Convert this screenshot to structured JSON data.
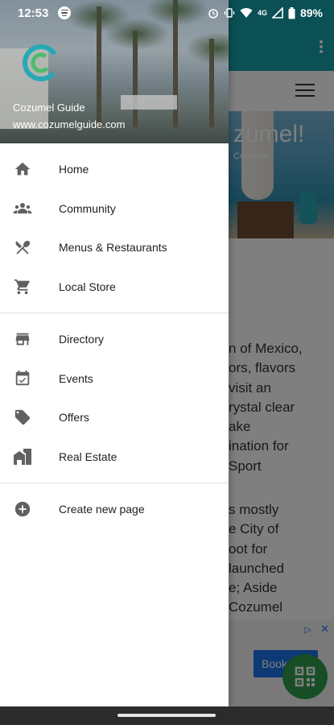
{
  "status_bar": {
    "time": "12:53",
    "network": "4G",
    "battery": "89%"
  },
  "background": {
    "hero_title": "zumel!",
    "hero_subtitle": "Cozumel",
    "paragraph_1": "n of Mexico,\nors, flavors\nvisit an\nrystal clear\nake\nination for\nSport",
    "paragraph_2": "s mostly\ne City of\noot for\nlaunched\ne; Aside\nCozumel",
    "ad_cta": "Book"
  },
  "drawer": {
    "header": {
      "title": "Cozumel Guide",
      "url": "www.cozumelguide.com"
    },
    "groups": [
      [
        {
          "label": "Home",
          "icon": "home-icon"
        },
        {
          "label": "Community",
          "icon": "community-icon"
        },
        {
          "label": "Menus & Restaurants",
          "icon": "restaurant-icon"
        },
        {
          "label": "Local Store",
          "icon": "cart-icon"
        }
      ],
      [
        {
          "label": "Directory",
          "icon": "store-icon"
        },
        {
          "label": "Events",
          "icon": "event-icon"
        },
        {
          "label": "Offers",
          "icon": "tag-icon"
        },
        {
          "label": "Real Estate",
          "icon": "building-icon"
        }
      ],
      [
        {
          "label": "Create new page",
          "icon": "add-circle-icon"
        }
      ]
    ]
  },
  "colors": {
    "app_bar": "#15a0a8",
    "icon": "#616161",
    "fab": "#2e9d4a"
  }
}
